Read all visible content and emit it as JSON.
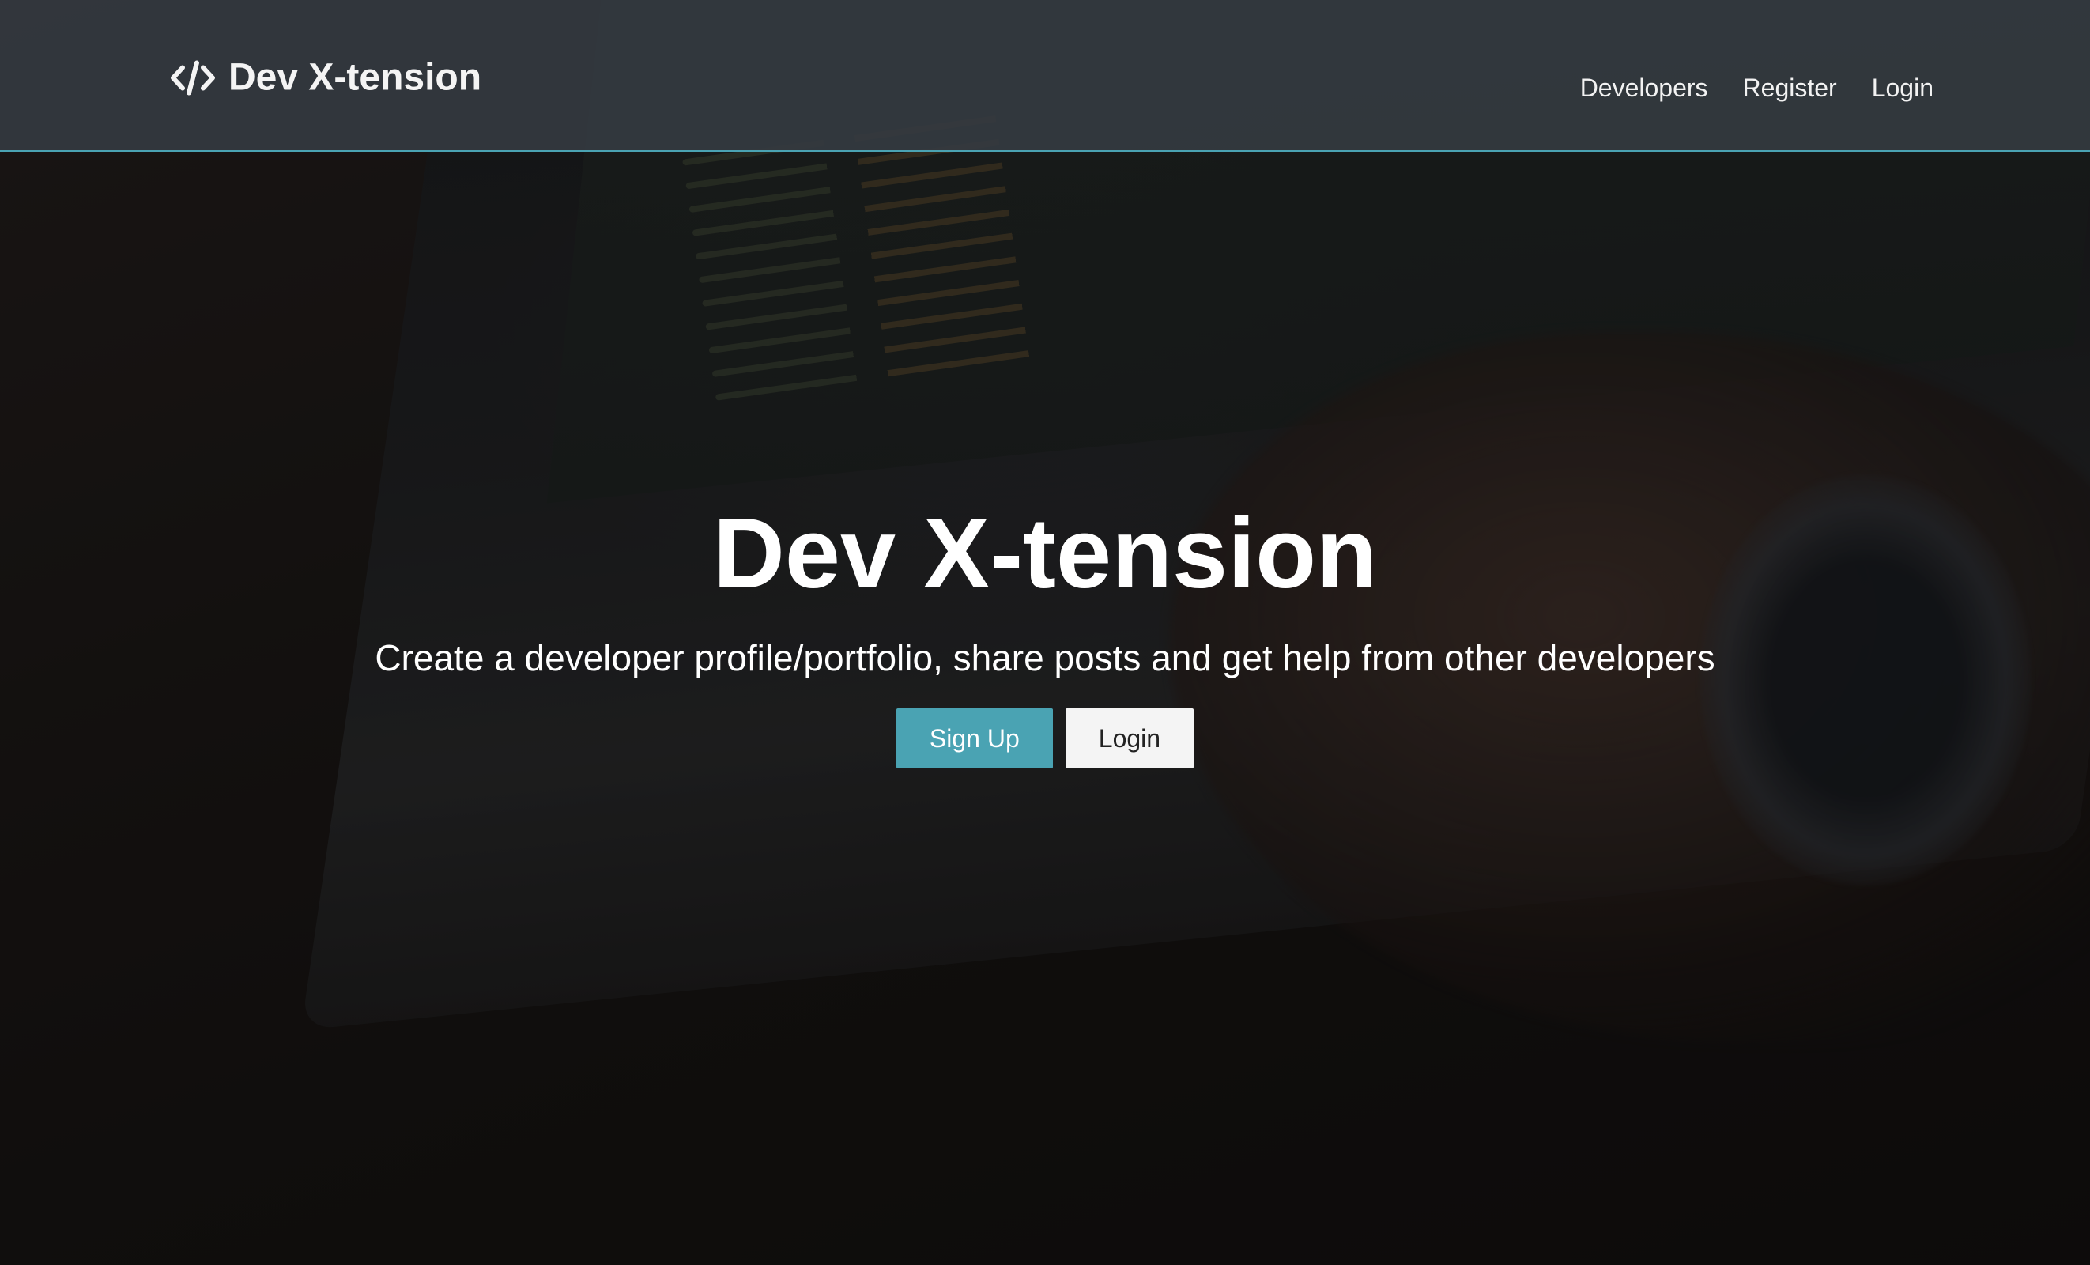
{
  "brand": {
    "icon": "code-icon",
    "name": "Dev X-tension"
  },
  "nav": {
    "links": [
      {
        "label": "Developers"
      },
      {
        "label": "Register"
      },
      {
        "label": "Login"
      }
    ]
  },
  "hero": {
    "title": "Dev X-tension",
    "lead": "Create a developer profile/portfolio, share posts and get help from other developers",
    "signup_label": "Sign Up",
    "login_label": "Login"
  },
  "colors": {
    "accent": "#4aa3b3",
    "navbar": "#343a40",
    "light_button": "#f4f4f4"
  }
}
